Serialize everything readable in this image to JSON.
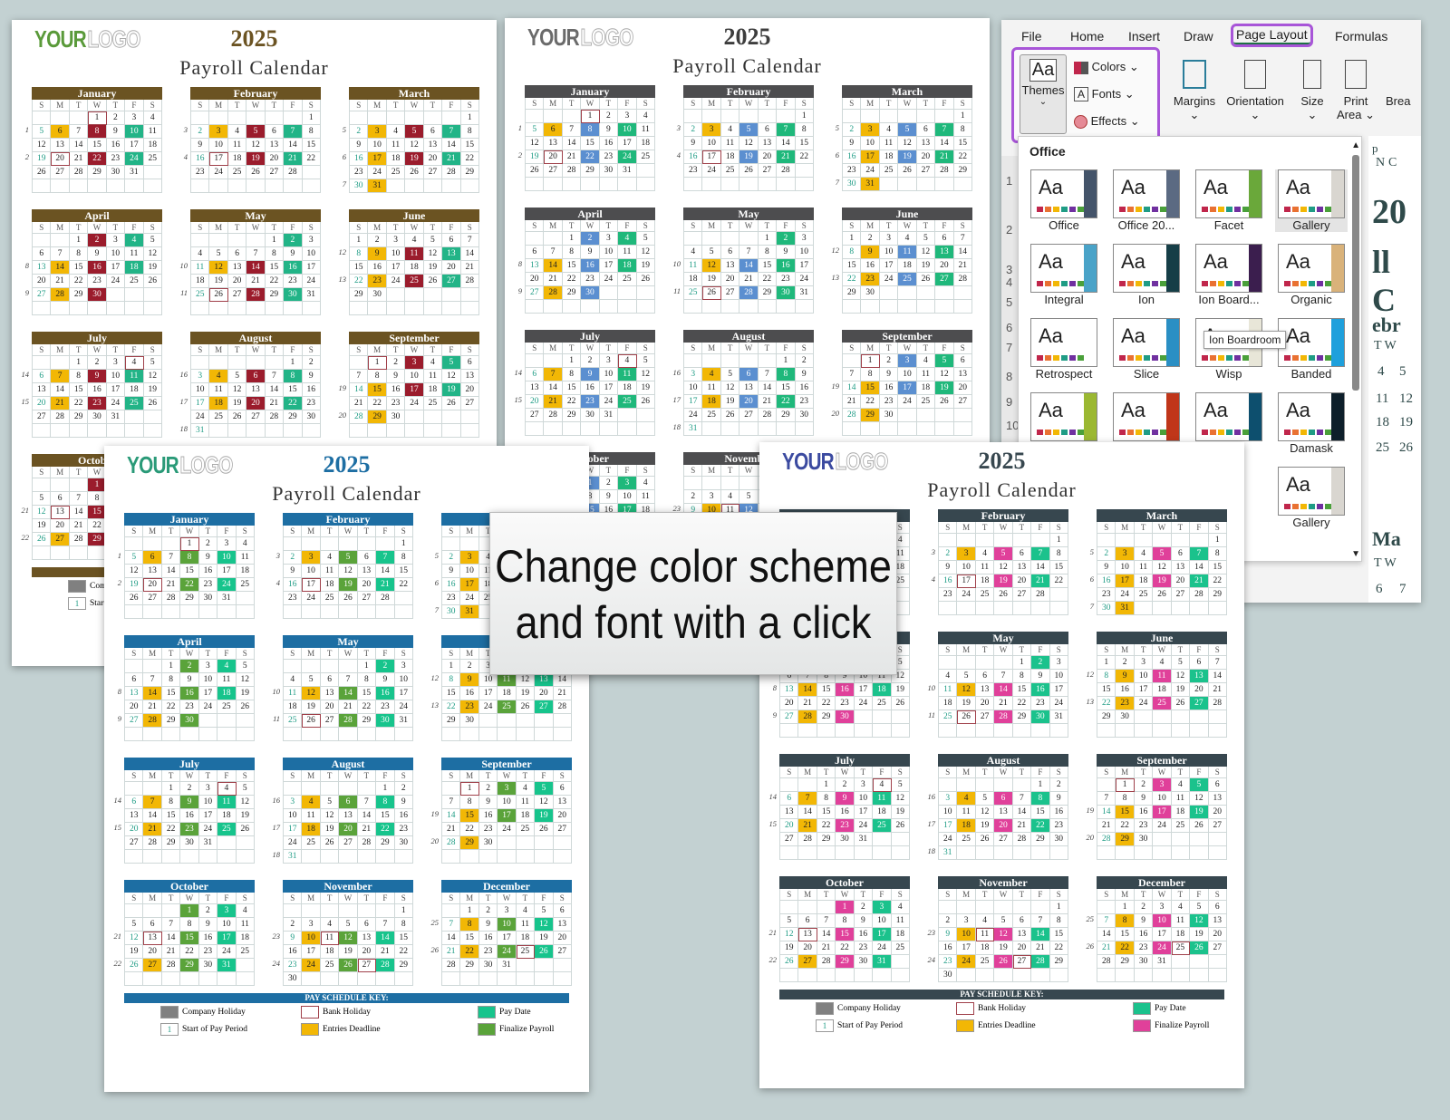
{
  "year": "2025",
  "title": "Payroll Calendar",
  "logo": {
    "word1": "YOUR",
    "word2": "LOGO"
  },
  "dow": [
    "S",
    "M",
    "T",
    "W",
    "T",
    "F",
    "S"
  ],
  "months": [
    "January",
    "February",
    "March",
    "April",
    "May",
    "June",
    "July",
    "August",
    "September",
    "October",
    "November",
    "December"
  ],
  "schedule": {
    "pay_dates": [
      "2025-01-10",
      "2025-01-24",
      "2025-02-07",
      "2025-02-21",
      "2025-03-07",
      "2025-03-21",
      "2025-04-04",
      "2025-04-18",
      "2025-05-02",
      "2025-05-16",
      "2025-05-30",
      "2025-06-13",
      "2025-06-27",
      "2025-07-11",
      "2025-07-25",
      "2025-08-08",
      "2025-08-22",
      "2025-09-05",
      "2025-09-19",
      "2025-10-03",
      "2025-10-17",
      "2025-10-31",
      "2025-11-14",
      "2025-11-28",
      "2025-12-12",
      "2025-12-26"
    ],
    "bank_holidays": [
      "2025-01-01",
      "2025-01-20",
      "2025-02-17",
      "2025-05-26",
      "2025-07-04",
      "2025-09-01",
      "2025-10-13",
      "2025-11-11",
      "2025-11-27",
      "2025-12-25"
    ]
  },
  "key": {
    "title": "PAY SCHEDULE KEY:",
    "company_holiday": "Company Holiday",
    "bank_holiday": "Bank Holiday",
    "pay_date": "Pay Date",
    "start_period": "Start of Pay Period",
    "start_sample": "1",
    "entries_deadline": "Entries Deadline",
    "finalize_payroll": "Finalize Payroll"
  },
  "sheets": [
    {
      "id": "brown",
      "header": "#6b5322",
      "year_color": "#6b5322",
      "logo_color": "#5a9a3a",
      "finalize": "#9b1c2c",
      "pay": "#22b487",
      "deadline": "#f2b705",
      "start": "#1f9c85"
    },
    {
      "id": "gray",
      "header": "#4d4d4f",
      "year_color": "#3d3d3d",
      "logo_color": "#6b6b6b",
      "finalize": "#5b8fd0",
      "pay": "#1fb87b",
      "deadline": "#f2b705",
      "start": "#1f9c85"
    },
    {
      "id": "blue",
      "header": "#1d6ea3",
      "year_color": "#1d6ea3",
      "logo_color": "#2a9a78",
      "finalize": "#5aa33a",
      "pay": "#17c48c",
      "deadline": "#f2b705",
      "start": "#1f9c85"
    },
    {
      "id": "slate",
      "header": "#37474f",
      "year_color": "#37474f",
      "logo_color": "#3b4aa0",
      "finalize": "#e0409a",
      "pay": "#1bc28c",
      "deadline": "#f2b705",
      "start": "#1f9c85"
    }
  ],
  "company_holiday_color": "#808080",
  "excel": {
    "tabs": [
      "File",
      "Home",
      "Insert",
      "Draw",
      "Page Layout",
      "Formulas"
    ],
    "active_tab": "Page Layout",
    "themes_label": "Themes",
    "colors_label": "Colors",
    "fonts_label": "Fonts",
    "effects_label": "Effects",
    "margins_label": "Margins",
    "orientation_label": "Orientation",
    "size_label": "Size",
    "print_area_label": "Print Area",
    "break_label": "Brea",
    "gallery_heading": "Office",
    "tooltip": "Ion Boardroom",
    "themes": [
      {
        "name": "Office",
        "side": "#44546a"
      },
      {
        "name": "Office 20...",
        "side": "#5b6a82"
      },
      {
        "name": "Facet",
        "side": "#6aa83a"
      },
      {
        "name": "Gallery",
        "side": "#d9d6d0"
      },
      {
        "name": "Integral",
        "side": "#4aa3c8"
      },
      {
        "name": "Ion",
        "side": "#163e47"
      },
      {
        "name": "Ion Board...",
        "side": "#3b1e4e"
      },
      {
        "name": "Organic",
        "side": "#d9b27a"
      },
      {
        "name": "Retrospect",
        "side": "#ffffff"
      },
      {
        "name": "Slice",
        "side": "#2a8fc4"
      },
      {
        "name": "Wisp",
        "side": "#e8e6d8"
      },
      {
        "name": "Banded",
        "side": "#1ea0dc"
      },
      {
        "name": "",
        "side": "#9bb832"
      },
      {
        "name": "",
        "side": "#c0361a"
      },
      {
        "name": "",
        "side": "#0d4f6e"
      },
      {
        "name": "Damask",
        "side": "#0d1f2a"
      },
      {
        "name": "Gallery",
        "side": "#d9d6d0"
      }
    ],
    "row_numbers": [
      "1",
      "2",
      "3",
      "4",
      "5",
      "6",
      "7",
      "8",
      "9",
      "10"
    ],
    "sheet_peek": [
      "p",
      "N",
      "C",
      "20",
      "ll C",
      "ebr",
      "T W",
      "4",
      "5",
      "11",
      "12",
      "18",
      "19",
      "25",
      "26",
      "Ma",
      "T W",
      "6",
      "7"
    ]
  },
  "callout": {
    "line1": "Change color scheme",
    "line2": "and font with a click"
  }
}
